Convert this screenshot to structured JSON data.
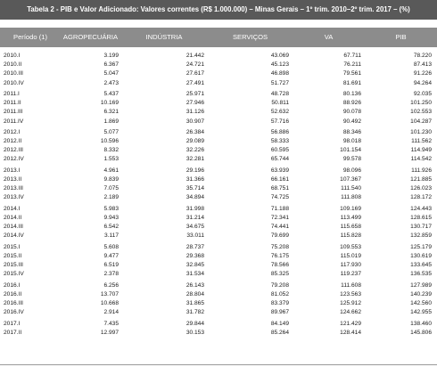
{
  "title": "Tabela 2 - PIB e Valor Adicionado: Valores correntes (R$ 1.000.000) – Minas Gerais – 1º trim. 2010–2º trim. 2017 – (%)",
  "columns": [
    "Período (1)",
    "AGROPECUÁRIA",
    "INDÚSTRIA",
    "SERVIÇOS",
    "VA",
    "PIB"
  ],
  "rows": [
    [
      "2010.I",
      "3.199",
      "21.442",
      "43.069",
      "67.711",
      "78.220"
    ],
    [
      "2010.II",
      "6.367",
      "24.721",
      "45.123",
      "76.211",
      "87.413"
    ],
    [
      "2010.III",
      "5.047",
      "27.617",
      "46.898",
      "79.561",
      "91.226"
    ],
    [
      "2010.IV",
      "2.473",
      "27.491",
      "51.727",
      "81.691",
      "94.264"
    ],
    [
      "2011.I",
      "5.437",
      "25.971",
      "48.728",
      "80.136",
      "92.035"
    ],
    [
      "2011.II",
      "10.169",
      "27.946",
      "50.811",
      "88.926",
      "101.250"
    ],
    [
      "2011.III",
      "6.321",
      "31.126",
      "52.632",
      "90.078",
      "102.553"
    ],
    [
      "2011.IV",
      "1.869",
      "30.907",
      "57.716",
      "90.492",
      "104.287"
    ],
    [
      "2012.I",
      "5.077",
      "26.384",
      "56.886",
      "88.346",
      "101.230"
    ],
    [
      "2012.II",
      "10.596",
      "29.089",
      "58.333",
      "98.018",
      "111.562"
    ],
    [
      "2012.III",
      "8.332",
      "32.226",
      "60.595",
      "101.154",
      "114.949"
    ],
    [
      "2012.IV",
      "1.553",
      "32.281",
      "65.744",
      "99.578",
      "114.542"
    ],
    [
      "2013.I",
      "4.961",
      "29.196",
      "63.939",
      "98.096",
      "111.926"
    ],
    [
      "2013.II",
      "9.839",
      "31.366",
      "66.161",
      "107.367",
      "121.885"
    ],
    [
      "2013.III",
      "7.075",
      "35.714",
      "68.751",
      "111.540",
      "126.023"
    ],
    [
      "2013.IV",
      "2.189",
      "34.894",
      "74.725",
      "111.808",
      "128.172"
    ],
    [
      "2014.I",
      "5.983",
      "31.998",
      "71.188",
      "109.169",
      "124.443"
    ],
    [
      "2014.II",
      "9.943",
      "31.214",
      "72.341",
      "113.499",
      "128.615"
    ],
    [
      "2014.III",
      "6.542",
      "34.675",
      "74.441",
      "115.658",
      "130.717"
    ],
    [
      "2014.IV",
      "3.117",
      "33.011",
      "79.699",
      "115.828",
      "132.859"
    ],
    [
      "2015.I",
      "5.608",
      "28.737",
      "75.208",
      "109.553",
      "125.179"
    ],
    [
      "2015.II",
      "9.477",
      "29.368",
      "76.175",
      "115.019",
      "130.619"
    ],
    [
      "2015.III",
      "6.519",
      "32.845",
      "78.566",
      "117.930",
      "133.645"
    ],
    [
      "2015.IV",
      "2.378",
      "31.534",
      "85.325",
      "119.237",
      "136.535"
    ],
    [
      "2016.I",
      "6.256",
      "26.143",
      "79.208",
      "111.608",
      "127.989"
    ],
    [
      "2016.II",
      "13.707",
      "28.804",
      "81.052",
      "123.563",
      "140.239"
    ],
    [
      "2016.III",
      "10.668",
      "31.865",
      "83.379",
      "125.912",
      "142.560"
    ],
    [
      "2016.IV",
      "2.914",
      "31.782",
      "89.967",
      "124.662",
      "142.955"
    ],
    [
      "2017.I",
      "7.435",
      "29.844",
      "84.149",
      "121.429",
      "138.460"
    ],
    [
      "2017.II",
      "12.997",
      "30.153",
      "85.264",
      "128.414",
      "145.806"
    ]
  ]
}
